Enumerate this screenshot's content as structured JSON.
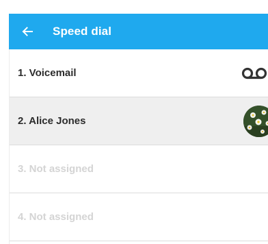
{
  "app_bar": {
    "title": "Speed dial",
    "back_icon": "arrow-left-icon",
    "color": "#1fa9ee"
  },
  "list": {
    "items": [
      {
        "label": "1. Voicemail",
        "trailing_icon": "voicemail-icon",
        "assigned": true
      },
      {
        "label": "2. Alice Jones",
        "trailing_icon": "contact-avatar",
        "assigned": true
      },
      {
        "label": "3. Not assigned",
        "assigned": false
      },
      {
        "label": "4. Not assigned",
        "assigned": false
      }
    ]
  },
  "colors": {
    "accent": "#1fa9ee",
    "selected_row": "#efefef",
    "unassigned_text": "#d4d4d4",
    "text": "#2b2b2b"
  }
}
